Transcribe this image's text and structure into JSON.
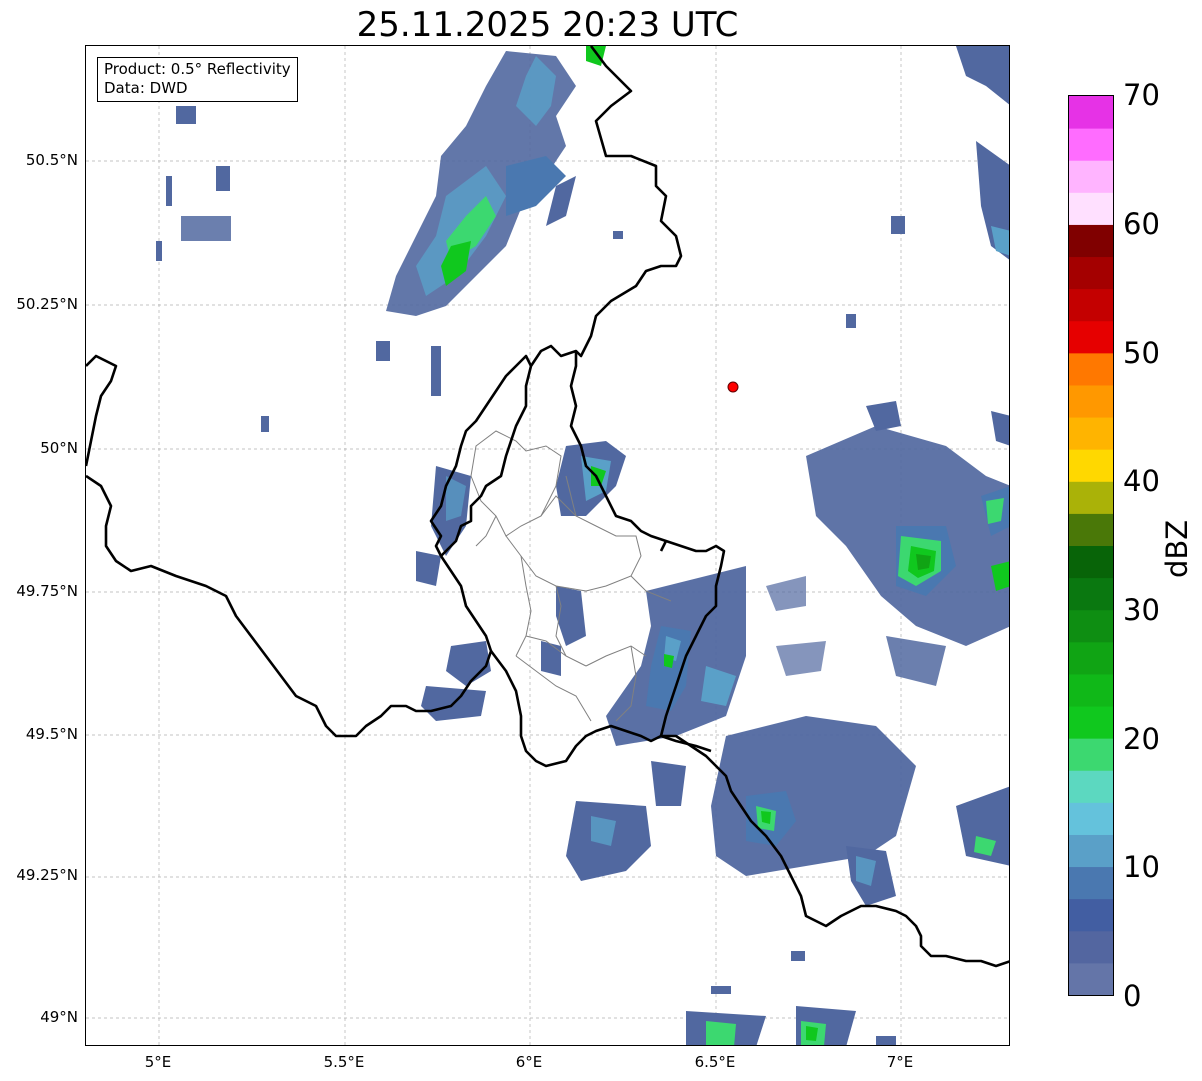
{
  "title": "25.11.2025 20:23 UTC",
  "info_box": {
    "product": "Product: 0.5° Reflectivity",
    "data": "Data: DWD"
  },
  "latitude_ticks": [
    "50.5°N",
    "50.25°N",
    "50°N",
    "49.75°N",
    "49.5°N",
    "49.25°N",
    "49°N"
  ],
  "longitude_ticks": [
    "5°E",
    "5.5°E",
    "6°E",
    "6.5°E",
    "7°E"
  ],
  "colorbar": {
    "label": "dBZ",
    "ticks": [
      "0",
      "10",
      "20",
      "30",
      "40",
      "50",
      "60",
      "70"
    ],
    "colors": [
      "#6475a8",
      "#5366a0",
      "#425ea2",
      "#4a78b0",
      "#5aa0c8",
      "#64c2dc",
      "#5cd8c0",
      "#3cd870",
      "#10c81e",
      "#10b818",
      "#10a414",
      "#0e8e12",
      "#0a7810",
      "#086408",
      "#4a7808",
      "#aab208",
      "#ffd800",
      "#ffb400",
      "#ff9800",
      "#ff7800",
      "#e60000",
      "#c40000",
      "#a40000",
      "#800000",
      "#ffe0ff",
      "#ffb4ff",
      "#ff6cff",
      "#e632e6"
    ]
  },
  "radar_site_marker_color": "#ff0000",
  "border_colors": {
    "country": "#000000",
    "district": "#808080"
  }
}
